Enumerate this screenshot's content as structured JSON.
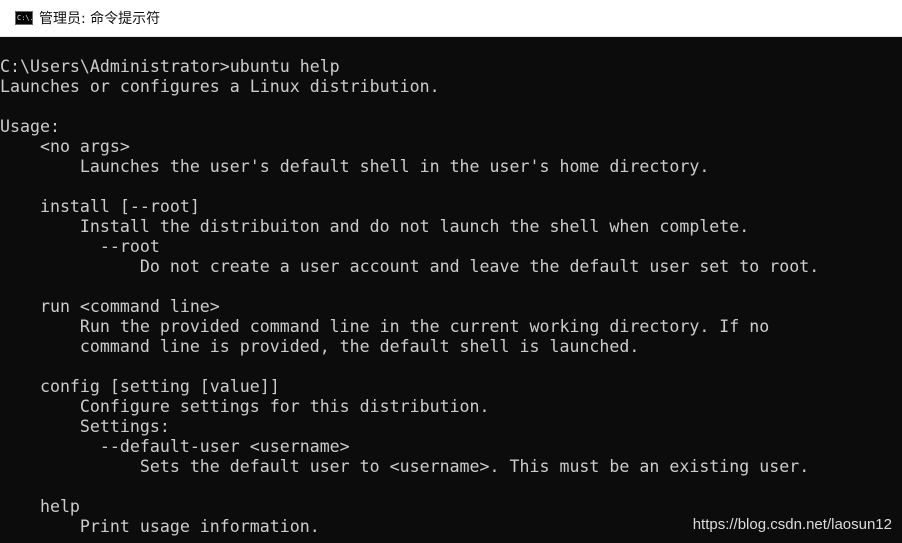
{
  "window": {
    "title": "管理员: 命令提示符",
    "icon_text": "C:\\."
  },
  "console": {
    "lines": [
      "C:\\Users\\Administrator>ubuntu help",
      "Launches or configures a Linux distribution.",
      "",
      "Usage:",
      "    <no args>",
      "        Launches the user's default shell in the user's home directory.",
      "",
      "    install [--root]",
      "        Install the distribuiton and do not launch the shell when complete.",
      "          --root",
      "              Do not create a user account and leave the default user set to root.",
      "",
      "    run <command line>",
      "        Run the provided command line in the current working directory. If no",
      "        command line is provided, the default shell is launched.",
      "",
      "    config [setting [value]]",
      "        Configure settings for this distribution.",
      "        Settings:",
      "          --default-user <username>",
      "              Sets the default user to <username>. This must be an existing user.",
      "",
      "    help",
      "        Print usage information."
    ]
  },
  "watermark": "https://blog.csdn.net/laosun12"
}
